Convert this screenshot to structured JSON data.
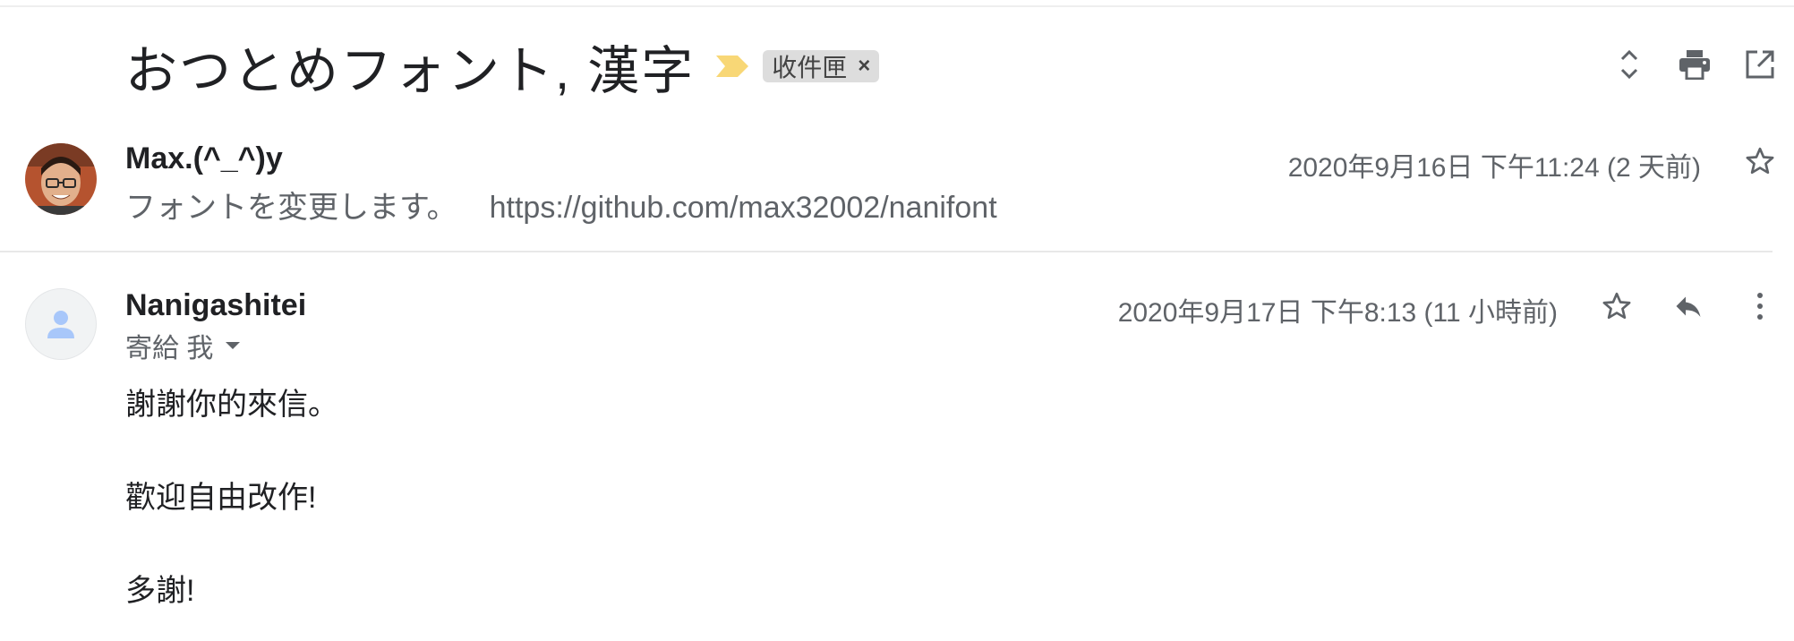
{
  "thread": {
    "subject": "おつとめフォント, 漢字",
    "label": "收件匣",
    "label_remove": "×",
    "icons": {
      "importance": "importance-marker-icon",
      "expand": "expand-collapse-icon",
      "print": "print-icon",
      "new_window": "open-in-new-window-icon"
    },
    "colors": {
      "importance": "#f8d776",
      "chip_bg": "#dddddd"
    }
  },
  "messages": [
    {
      "sender": "Max.(^_^)y",
      "date": "2020年9月16日 下午11:24 (2 天前)",
      "snippet": "フォントを変更します。",
      "snippet_link": "https://github.com/max32002/nanifont",
      "icons": {
        "star": "star-icon",
        "avatar": "profile-photo"
      }
    },
    {
      "sender": "Nanigashitei",
      "date": "2020年9月17日 下午8:13 (11 小時前)",
      "recipient": "寄給 我",
      "body": [
        "謝謝你的來信。",
        "歡迎自由改作!",
        "多謝!"
      ],
      "icons": {
        "star": "star-icon",
        "reply": "reply-icon",
        "more": "more-vert-icon",
        "avatar": "default-person-icon"
      }
    }
  ]
}
